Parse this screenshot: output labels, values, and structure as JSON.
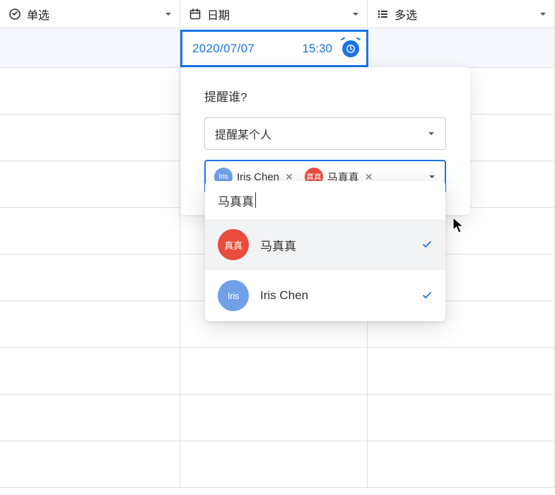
{
  "columns": {
    "single_select": "单选",
    "date": "日期",
    "multi_select": "多选"
  },
  "date_cell": {
    "date": "2020/07/07",
    "time": "15:30"
  },
  "reminder": {
    "prompt": "提醒谁?",
    "mode_label": "提醒某个人",
    "selected": [
      {
        "avatar_text": "Iris",
        "name": "Iris Chen",
        "avatar_class": "av-iris"
      },
      {
        "avatar_text": "真真",
        "name": "马真真",
        "avatar_class": "av-zhen"
      }
    ]
  },
  "search": {
    "query": "马真真",
    "results": [
      {
        "avatar_text": "真真",
        "name": "马真真",
        "avatar_class": "av-zhen",
        "highlight": true
      },
      {
        "avatar_text": "Iris",
        "name": "Iris Chen",
        "avatar_class": "av-iris",
        "highlight": false
      }
    ]
  }
}
